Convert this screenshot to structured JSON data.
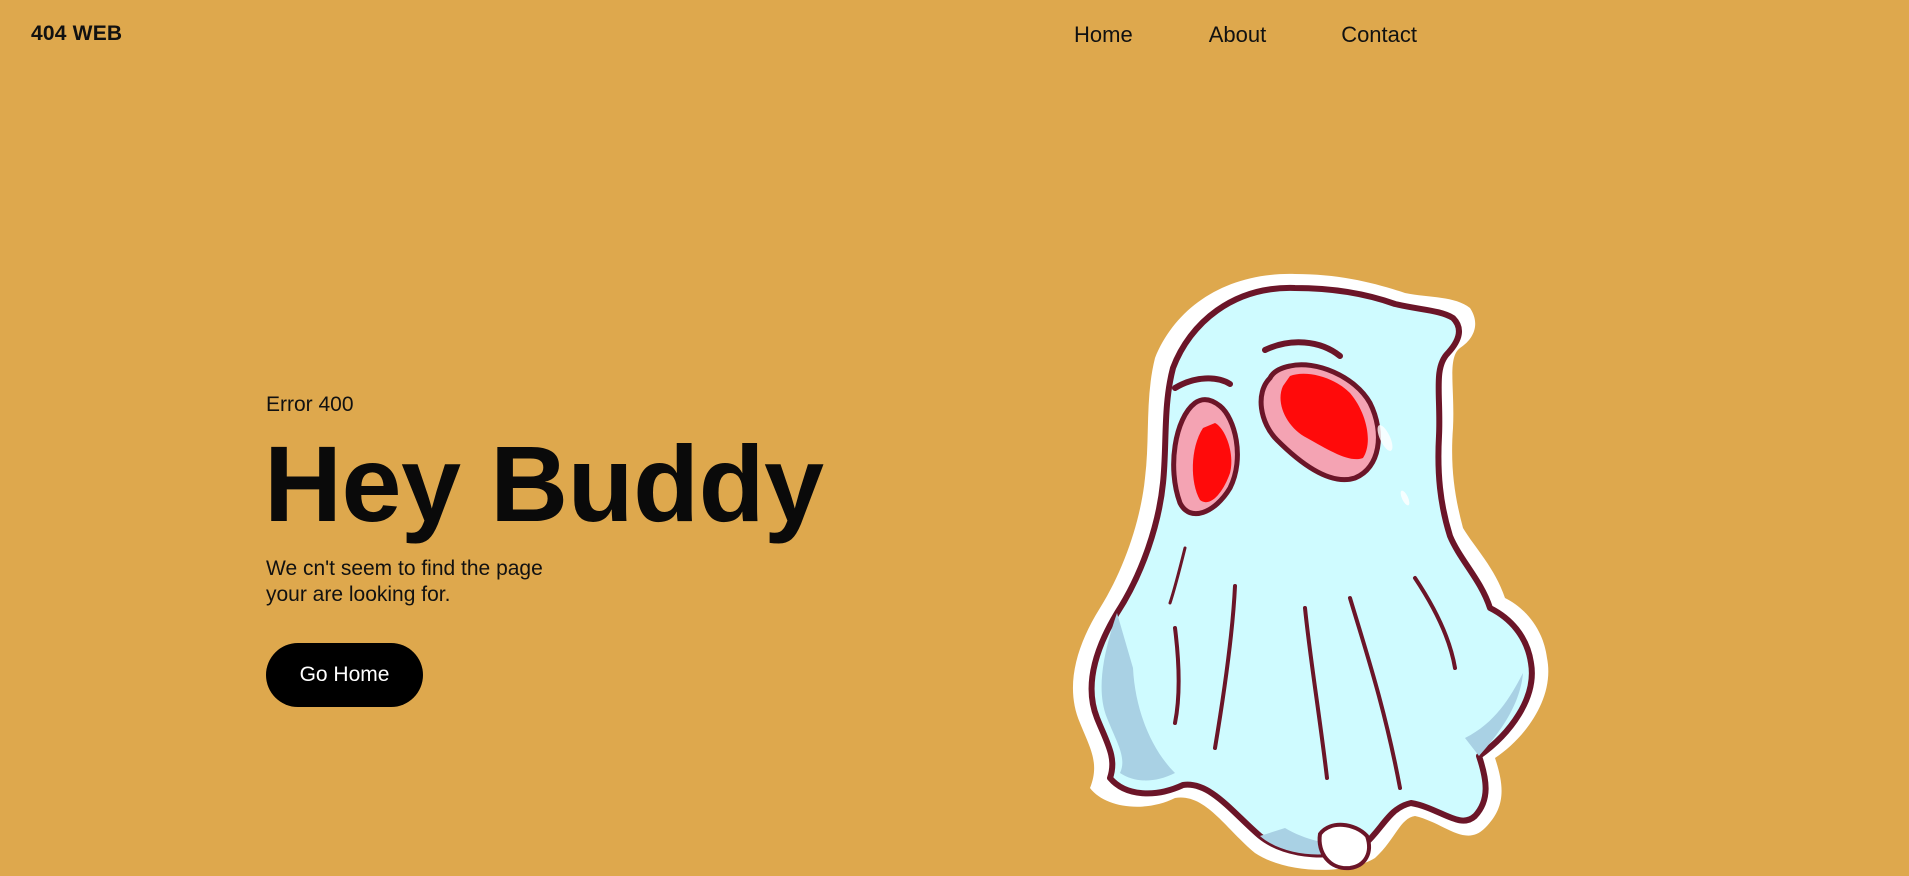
{
  "brand": {
    "logo_text": "404 WEB"
  },
  "nav": {
    "items": [
      {
        "label": "Home"
      },
      {
        "label": "About"
      },
      {
        "label": "Contact"
      }
    ]
  },
  "hero": {
    "error_code": "Error 400",
    "headline": "Hey Buddy",
    "message_line1": "We cn't seem to find the page",
    "message_line2": "your are looking for.",
    "button_label": "Go Home"
  },
  "colors": {
    "background": "#DEA84D",
    "button_bg": "#000000",
    "ghost_body": "#CFFBFF",
    "ghost_outline": "#6B1528",
    "ghost_eye": "#FF0A0A"
  },
  "illustration": {
    "icon": "ghost-icon"
  }
}
